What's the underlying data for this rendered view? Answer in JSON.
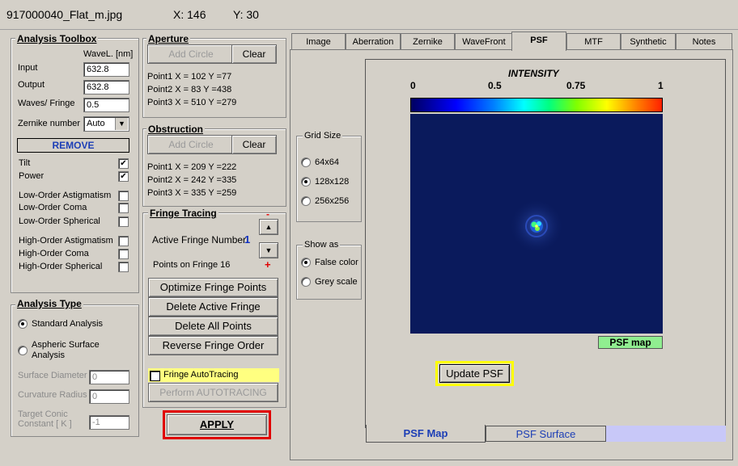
{
  "title_bar": {
    "filename": "917000040_Flat_m.jpg",
    "x_readout": "X: 146",
    "y_readout": "Y: 30"
  },
  "toolbox": {
    "title": "Analysis Toolbox",
    "wavel_label": "WaveL. [nm]",
    "input_label": "Input",
    "input_value": "632.8",
    "output_label": "Output",
    "output_value": "632.8",
    "waves_label": "Waves/ Fringe",
    "waves_value": "0.5",
    "zernike_label": "Zernike number",
    "zernike_value": "Auto",
    "remove_label": "REMOVE",
    "terms": [
      {
        "label": "Tilt",
        "checked": true
      },
      {
        "label": "Power",
        "checked": true
      },
      {
        "label": "Low-Order  Astigmatism",
        "checked": false
      },
      {
        "label": "Low-Order  Coma",
        "checked": false
      },
      {
        "label": "Low-Order  Spherical",
        "checked": false
      },
      {
        "label": "High-Order  Astigmatism",
        "checked": false
      },
      {
        "label": "High-Order  Coma",
        "checked": false
      },
      {
        "label": "High-Order  Spherical",
        "checked": false
      }
    ]
  },
  "analysis_type": {
    "title": "Analysis Type",
    "standard": "Standard  Analysis",
    "aspheric_line1": "Aspheric  Surface",
    "aspheric_line2": "Analysis",
    "surface_diameter_label": "Surface Diameter",
    "surface_diameter_value": "0",
    "curvature_radius_label": "Curvature Radius",
    "curvature_radius_value": "0",
    "target_conic_line1": "Target Conic",
    "target_conic_line2": "Constant [ K ]",
    "target_conic_value": "-1"
  },
  "aperture": {
    "title": "Aperture",
    "add_circle": "Add Circle",
    "clear": "Clear",
    "points": [
      "Point1  X =   102   Y =77",
      "Point2  X =   83   Y =438",
      "Point3  X =   510   Y =279"
    ]
  },
  "obstruction": {
    "title": "Obstruction",
    "add_circle": "Add Circle",
    "clear": "Clear",
    "points": [
      "Point1  X =   209   Y =222",
      "Point2  X =   242   Y =335",
      "Point3  X =   335   Y =259"
    ]
  },
  "fringe": {
    "title": "Fringe Tracing",
    "active_label": "Active Fringe Number",
    "active_value": "1",
    "points_label": "Points on  Fringe 16",
    "minus": "-",
    "plus": "+",
    "optimize": "Optimize Fringe Points",
    "delete_active": "Delete Active Fringe",
    "delete_all": "Delete  All  Points",
    "reverse": "Reverse  Fringe Order",
    "autotracing": "Fringe AutoTracing",
    "perform": "Perform  AUTOTRACING"
  },
  "apply_label": "APPLY",
  "tabs": [
    "Image",
    "Aberration",
    "Zernike",
    "WaveFront",
    "PSF",
    "MTF",
    "Synthetic",
    "Notes"
  ],
  "active_tab": "PSF",
  "grid_size": {
    "title": "Grid Size",
    "options": [
      "64x64",
      "128x128",
      "256x256"
    ],
    "selected": "128x128"
  },
  "show_as": {
    "title": "Show as",
    "options": [
      "False color",
      "Grey scale"
    ],
    "selected": "False color"
  },
  "psf": {
    "intensity_label": "INTENSITY",
    "scale_ticks": [
      "0",
      "0.5",
      "0.75",
      "1"
    ],
    "map_label": "PSF map",
    "update_button": "Update PSF"
  },
  "bottom_tabs": {
    "map": "PSF  Map",
    "surface": "PSF Surface"
  },
  "colors": {
    "highlight_red": "#e00000",
    "highlight_yellow": "#ffff00",
    "psf_background": "#0a1a5c",
    "map_label_bg": "#90ee90",
    "active_fringe": "#1030c0"
  }
}
